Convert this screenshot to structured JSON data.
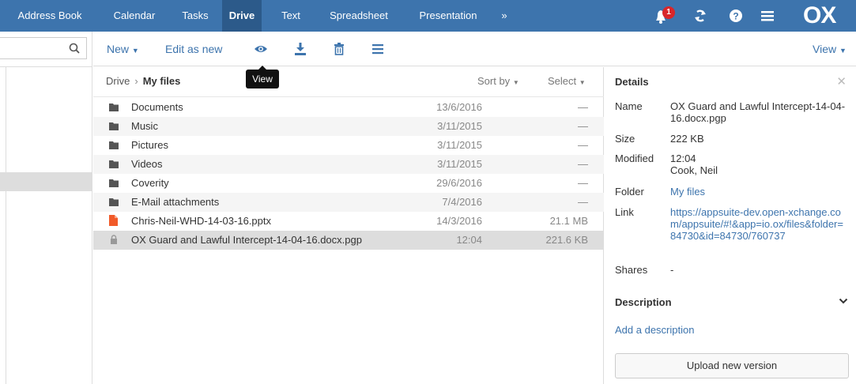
{
  "nav": {
    "items": [
      "Address Book",
      "Calendar",
      "Tasks",
      "Drive",
      "Text",
      "Spreadsheet",
      "Presentation",
      "»"
    ],
    "active": "Drive",
    "notification_count": "1",
    "logo": "OX",
    "icons": [
      "bell-icon",
      "refresh-icon",
      "help-icon",
      "hamburger-menu-icon"
    ]
  },
  "toolbar": {
    "new_label": "New",
    "edit_label": "Edit as new",
    "view_label": "View",
    "tooltip": "View",
    "icons": [
      "eye-icon",
      "download-icon",
      "trash-icon",
      "more-icon"
    ]
  },
  "breadcrumb": {
    "root": "Drive",
    "separator": "›",
    "current": "My files"
  },
  "list": {
    "sort_label": "Sort by",
    "select_label": "Select",
    "rows": [
      {
        "name": "Documents",
        "date": "13/6/2016",
        "size": "—",
        "type": "folder"
      },
      {
        "name": "Music",
        "date": "3/11/2015",
        "size": "—",
        "type": "folder"
      },
      {
        "name": "Pictures",
        "date": "3/11/2015",
        "size": "—",
        "type": "folder"
      },
      {
        "name": "Videos",
        "date": "3/11/2015",
        "size": "—",
        "type": "folder"
      },
      {
        "name": "Coverity",
        "date": "29/6/2016",
        "size": "—",
        "type": "folder"
      },
      {
        "name": "E-Mail attachments",
        "date": "7/4/2016",
        "size": "—",
        "type": "folder"
      },
      {
        "name": "Chris-Neil-WHD-14-03-16.pptx",
        "date": "14/3/2016",
        "size": "21.1 MB",
        "type": "pptx"
      },
      {
        "name": "OX Guard and Lawful Intercept-14-04-16.docx.pgp",
        "date": "12:04",
        "size": "221.6 KB",
        "type": "locked"
      }
    ]
  },
  "details": {
    "title": "Details",
    "name_label": "Name",
    "name_value": "OX Guard and Lawful Intercept-14-04-16.docx.pgp",
    "size_label": "Size",
    "size_value": "222 KB",
    "modified_label": "Modified",
    "modified_time": "12:04",
    "modified_by": "Cook, Neil",
    "folder_label": "Folder",
    "folder_value": "My files",
    "link_label": "Link",
    "link_value": "https://appsuite-dev.open-xchange.com/appsuite/#!&app=io.ox/files&folder=84730&id=84730/760737",
    "shares_label": "Shares",
    "shares_value": "-",
    "description_label": "Description",
    "add_description": "Add a description",
    "upload_label": "Upload new version"
  },
  "colors": {
    "brand": "#3d74ad",
    "nav_active": "#2c5a8a",
    "badge": "#d9262a",
    "pptx": "#f15a29"
  }
}
